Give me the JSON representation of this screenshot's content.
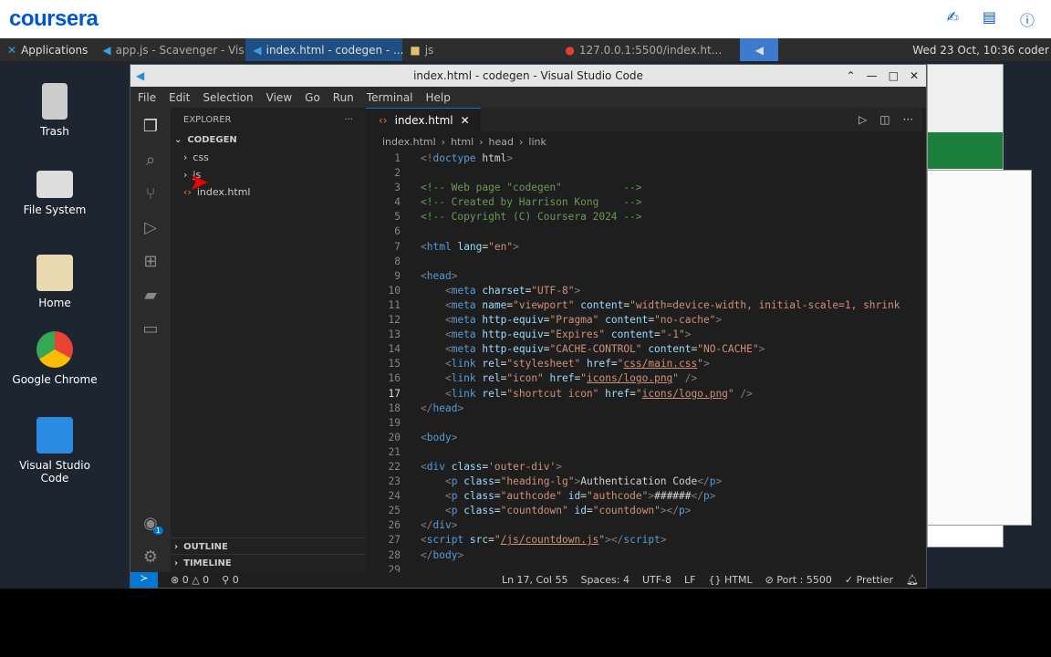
{
  "coursera": {
    "logo": "coursera",
    "icons": [
      "translate-icon",
      "notes-icon",
      "help-icon"
    ]
  },
  "taskbar": {
    "apps_label": "Applications",
    "tasks": [
      "app.js - Scavenger - Vis...",
      "index.html - codegen - ...",
      "js",
      "127.0.0.1:5500/index.ht..."
    ],
    "clock": "Wed 23 Oct, 10:36 coder"
  },
  "desktop": {
    "icons": [
      "Trash",
      "File System",
      "Home",
      "Google Chrome",
      "Visual Studio Code"
    ]
  },
  "vscode": {
    "title": "index.html - codegen - Visual Studio Code",
    "menu": [
      "File",
      "Edit",
      "Selection",
      "View",
      "Go",
      "Run",
      "Terminal",
      "Help"
    ],
    "explorer": {
      "header": "EXPLORER",
      "root": "CODEGEN",
      "items": [
        "css",
        "js",
        "index.html"
      ],
      "outline": "OUTLINE",
      "timeline": "TIMELINE"
    },
    "tab": "index.html",
    "breadcrumb": [
      "index.html",
      "html",
      "head",
      "link"
    ],
    "badge": "1",
    "current_line": 17,
    "code": [
      [
        [
          "p",
          "<!"
        ],
        [
          "t",
          "doctype"
        ],
        [
          "x",
          " html"
        ],
        [
          "p",
          ">"
        ]
      ],
      [],
      [
        [
          "c",
          "<!-- Web page \"codegen\"          -->"
        ]
      ],
      [
        [
          "c",
          "<!-- Created by Harrison Kong    -->"
        ]
      ],
      [
        [
          "c",
          "<!-- Copyright (C) Coursera 2024 -->"
        ]
      ],
      [],
      [
        [
          "p",
          "<"
        ],
        [
          "t",
          "html"
        ],
        [
          "x",
          " "
        ],
        [
          "a",
          "lang"
        ],
        [
          "x",
          "="
        ],
        [
          "s",
          "\"en\""
        ],
        [
          "p",
          ">"
        ]
      ],
      [],
      [
        [
          "p",
          "<"
        ],
        [
          "t",
          "head"
        ],
        [
          "p",
          ">"
        ]
      ],
      [
        [
          "x",
          "    "
        ],
        [
          "p",
          "<"
        ],
        [
          "t",
          "meta"
        ],
        [
          "x",
          " "
        ],
        [
          "a",
          "charset"
        ],
        [
          "x",
          "="
        ],
        [
          "s",
          "\"UTF-8\""
        ],
        [
          "p",
          ">"
        ]
      ],
      [
        [
          "x",
          "    "
        ],
        [
          "p",
          "<"
        ],
        [
          "t",
          "meta"
        ],
        [
          "x",
          " "
        ],
        [
          "a",
          "name"
        ],
        [
          "x",
          "="
        ],
        [
          "s",
          "\"viewport\""
        ],
        [
          "x",
          " "
        ],
        [
          "a",
          "content"
        ],
        [
          "x",
          "="
        ],
        [
          "s",
          "\"width=device-width, initial-scale=1, shrink"
        ]
      ],
      [
        [
          "x",
          "    "
        ],
        [
          "p",
          "<"
        ],
        [
          "t",
          "meta"
        ],
        [
          "x",
          " "
        ],
        [
          "a",
          "http-equiv"
        ],
        [
          "x",
          "="
        ],
        [
          "s",
          "\"Pragma\""
        ],
        [
          "x",
          " "
        ],
        [
          "a",
          "content"
        ],
        [
          "x",
          "="
        ],
        [
          "s",
          "\"no-cache\""
        ],
        [
          "p",
          ">"
        ]
      ],
      [
        [
          "x",
          "    "
        ],
        [
          "p",
          "<"
        ],
        [
          "t",
          "meta"
        ],
        [
          "x",
          " "
        ],
        [
          "a",
          "http-equiv"
        ],
        [
          "x",
          "="
        ],
        [
          "s",
          "\"Expires\""
        ],
        [
          "x",
          " "
        ],
        [
          "a",
          "content"
        ],
        [
          "x",
          "="
        ],
        [
          "s",
          "\"-1\""
        ],
        [
          "p",
          ">"
        ]
      ],
      [
        [
          "x",
          "    "
        ],
        [
          "p",
          "<"
        ],
        [
          "t",
          "meta"
        ],
        [
          "x",
          " "
        ],
        [
          "a",
          "http-equiv"
        ],
        [
          "x",
          "="
        ],
        [
          "s",
          "\"CACHE-CONTROL\""
        ],
        [
          "x",
          " "
        ],
        [
          "a",
          "content"
        ],
        [
          "x",
          "="
        ],
        [
          "s",
          "\"NO-CACHE\""
        ],
        [
          "p",
          ">"
        ]
      ],
      [
        [
          "x",
          "    "
        ],
        [
          "p",
          "<"
        ],
        [
          "t",
          "link"
        ],
        [
          "x",
          " "
        ],
        [
          "a",
          "rel"
        ],
        [
          "x",
          "="
        ],
        [
          "s",
          "\"stylesheet\""
        ],
        [
          "x",
          " "
        ],
        [
          "a",
          "href"
        ],
        [
          "x",
          "="
        ],
        [
          "s",
          "\""
        ],
        [
          "u",
          "css/main.css"
        ],
        [
          "s",
          "\""
        ],
        [
          "p",
          ">"
        ]
      ],
      [
        [
          "x",
          "    "
        ],
        [
          "p",
          "<"
        ],
        [
          "t",
          "link"
        ],
        [
          "x",
          " "
        ],
        [
          "a",
          "rel"
        ],
        [
          "x",
          "="
        ],
        [
          "s",
          "\"icon\""
        ],
        [
          "x",
          " "
        ],
        [
          "a",
          "href"
        ],
        [
          "x",
          "="
        ],
        [
          "s",
          "\""
        ],
        [
          "u",
          "icons/logo.png"
        ],
        [
          "s",
          "\""
        ],
        [
          "x",
          " "
        ],
        [
          "p",
          "/>"
        ]
      ],
      [
        [
          "x",
          "    "
        ],
        [
          "p",
          "<"
        ],
        [
          "t",
          "link"
        ],
        [
          "x",
          " "
        ],
        [
          "a",
          "rel"
        ],
        [
          "x",
          "="
        ],
        [
          "s",
          "\"shortcut icon\""
        ],
        [
          "x",
          " "
        ],
        [
          "a",
          "href"
        ],
        [
          "x",
          "="
        ],
        [
          "s",
          "\""
        ],
        [
          "u",
          "icons/logo.png"
        ],
        [
          "s",
          "\""
        ],
        [
          "x",
          " "
        ],
        [
          "p",
          "/>"
        ]
      ],
      [
        [
          "p",
          "</"
        ],
        [
          "t",
          "head"
        ],
        [
          "p",
          ">"
        ]
      ],
      [],
      [
        [
          "p",
          "<"
        ],
        [
          "t",
          "body"
        ],
        [
          "p",
          ">"
        ]
      ],
      [],
      [
        [
          "p",
          "<"
        ],
        [
          "t",
          "div"
        ],
        [
          "x",
          " "
        ],
        [
          "a",
          "class"
        ],
        [
          "x",
          "="
        ],
        [
          "s",
          "'outer-div'"
        ],
        [
          "p",
          ">"
        ]
      ],
      [
        [
          "x",
          "    "
        ],
        [
          "p",
          "<"
        ],
        [
          "t",
          "p"
        ],
        [
          "x",
          " "
        ],
        [
          "a",
          "class"
        ],
        [
          "x",
          "="
        ],
        [
          "s",
          "\"heading-lg\""
        ],
        [
          "p",
          ">"
        ],
        [
          "x",
          "Authentication Code"
        ],
        [
          "p",
          "</"
        ],
        [
          "t",
          "p"
        ],
        [
          "p",
          ">"
        ]
      ],
      [
        [
          "x",
          "    "
        ],
        [
          "p",
          "<"
        ],
        [
          "t",
          "p"
        ],
        [
          "x",
          " "
        ],
        [
          "a",
          "class"
        ],
        [
          "x",
          "="
        ],
        [
          "s",
          "\"authcode\""
        ],
        [
          "x",
          " "
        ],
        [
          "a",
          "id"
        ],
        [
          "x",
          "="
        ],
        [
          "s",
          "\"authcode\""
        ],
        [
          "p",
          ">"
        ],
        [
          "x",
          "######"
        ],
        [
          "p",
          "</"
        ],
        [
          "t",
          "p"
        ],
        [
          "p",
          ">"
        ]
      ],
      [
        [
          "x",
          "    "
        ],
        [
          "p",
          "<"
        ],
        [
          "t",
          "p"
        ],
        [
          "x",
          " "
        ],
        [
          "a",
          "class"
        ],
        [
          "x",
          "="
        ],
        [
          "s",
          "\"countdown\""
        ],
        [
          "x",
          " "
        ],
        [
          "a",
          "id"
        ],
        [
          "x",
          "="
        ],
        [
          "s",
          "\"countdown\""
        ],
        [
          "p",
          "></"
        ],
        [
          "t",
          "p"
        ],
        [
          "p",
          ">"
        ]
      ],
      [
        [
          "p",
          "</"
        ],
        [
          "t",
          "div"
        ],
        [
          "p",
          ">"
        ]
      ],
      [
        [
          "p",
          "<"
        ],
        [
          "t",
          "script"
        ],
        [
          "x",
          " "
        ],
        [
          "a",
          "src"
        ],
        [
          "x",
          "="
        ],
        [
          "s",
          "\""
        ],
        [
          "u",
          "/js/countdown.js"
        ],
        [
          "s",
          "\""
        ],
        [
          "p",
          "></"
        ],
        [
          "t",
          "script"
        ],
        [
          "p",
          ">"
        ]
      ],
      [
        [
          "p",
          "</"
        ],
        [
          "t",
          "body"
        ],
        [
          "p",
          ">"
        ]
      ],
      []
    ],
    "status": {
      "errors": "0",
      "warnings": "0",
      "ports": "0",
      "position": "Ln 17, Col 55",
      "spaces": "Spaces: 4",
      "encoding": "UTF-8",
      "eol": "LF",
      "language": "HTML",
      "port": "Port : 5500",
      "formatter": "Prettier"
    }
  },
  "colors": {
    "coursera": "#0056d2",
    "vscode_accent": "#0078d4"
  }
}
